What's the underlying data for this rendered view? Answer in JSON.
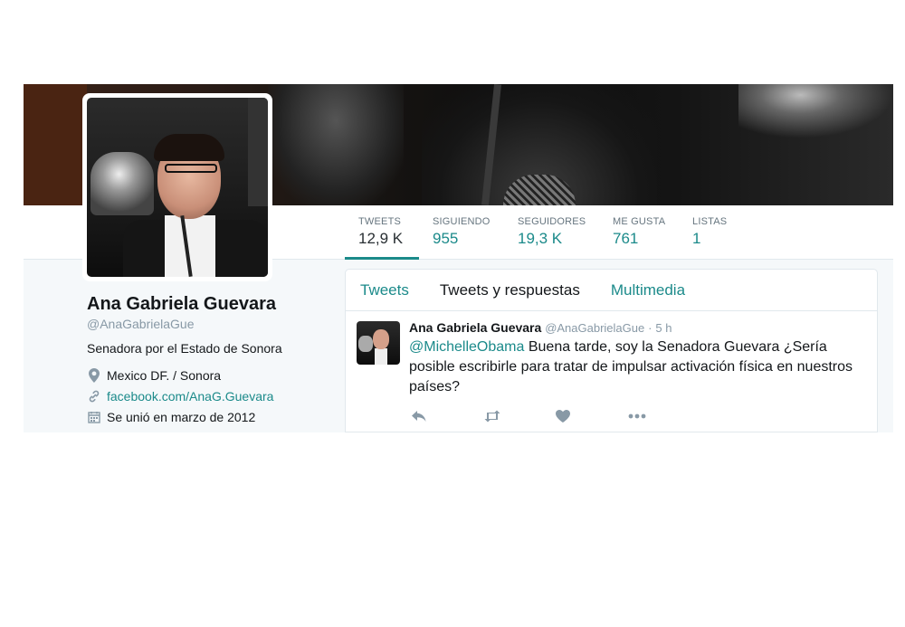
{
  "profile": {
    "name": "Ana Gabriela Guevara",
    "handle": "@AnaGabrielaGue",
    "bio": "Senadora por el Estado de Sonora",
    "location": "Mexico DF. / Sonora",
    "website": "facebook.com/AnaG.Guevara",
    "joined": "Se unió en marzo de 2012"
  },
  "stats": [
    {
      "label": "TWEETS",
      "value": "12,9 K"
    },
    {
      "label": "SIGUIENDO",
      "value": "955"
    },
    {
      "label": "SEGUIDORES",
      "value": "19,3 K"
    },
    {
      "label": "ME GUSTA",
      "value": "761"
    },
    {
      "label": "LISTAS",
      "value": "1"
    }
  ],
  "tabs": [
    "Tweets",
    "Tweets y respuestas",
    "Multimedia"
  ],
  "tweet": {
    "name": "Ana Gabriela Guevara",
    "handle": "@AnaGabrielaGue",
    "separator": "·",
    "time": "5 h",
    "mention": "@MichelleObama",
    "text": " Buena tarde, soy la Senadora Guevara ¿Sería posible escribirle para tratar de impulsar activación física en nuestros países?"
  },
  "icons": {
    "location": "map-pin-icon",
    "link": "link-icon",
    "calendar": "calendar-icon",
    "reply": "reply-icon",
    "retweet": "retweet-icon",
    "like": "heart-icon",
    "more": "more-icon"
  },
  "colors": {
    "accent": "#1b8a8a",
    "text": "#14171a",
    "muted": "#8899a6",
    "background": "#f5f8fa"
  }
}
